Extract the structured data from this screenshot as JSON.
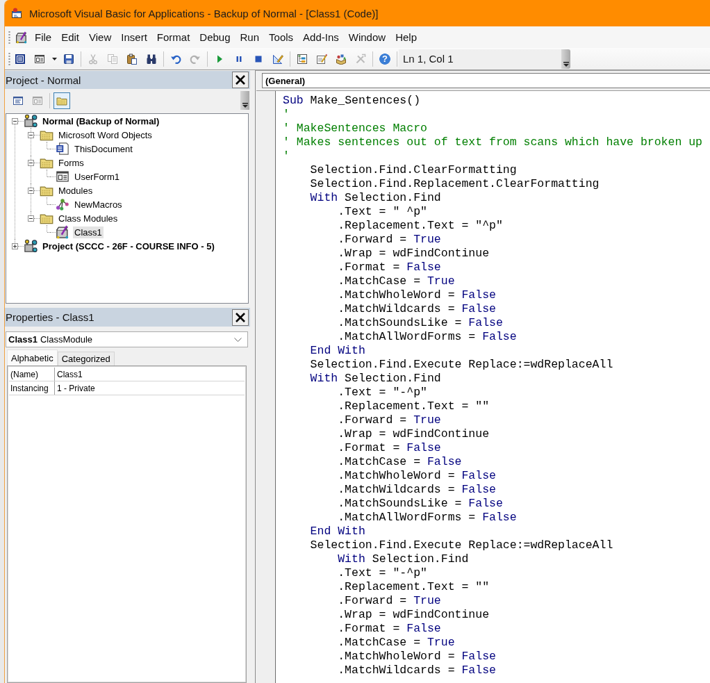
{
  "window": {
    "title": "Microsoft Visual Basic for Applications - Backup of Normal - [Class1 (Code)]"
  },
  "menu_bar": {
    "items": [
      {
        "label": "File"
      },
      {
        "label": "Edit"
      },
      {
        "label": "View"
      },
      {
        "label": "Insert"
      },
      {
        "label": "Format"
      },
      {
        "label": "Debug"
      },
      {
        "label": "Run"
      },
      {
        "label": "Tools"
      },
      {
        "label": "Add-Ins"
      },
      {
        "label": "Window"
      },
      {
        "label": "Help"
      }
    ]
  },
  "toolbar": {
    "items": [
      {
        "kind": "word",
        "disabled": false
      },
      {
        "kind": "userform",
        "disabled": false
      },
      {
        "kind": "save",
        "disabled": false
      },
      {
        "kind": "separator"
      },
      {
        "kind": "cut",
        "disabled": true
      },
      {
        "kind": "copy",
        "disabled": true
      },
      {
        "kind": "paste",
        "disabled": false
      },
      {
        "kind": "find",
        "disabled": false
      },
      {
        "kind": "separator"
      },
      {
        "kind": "undo",
        "disabled": false
      },
      {
        "kind": "redo",
        "disabled": true
      },
      {
        "kind": "separator"
      },
      {
        "kind": "run",
        "disabled": false
      },
      {
        "kind": "pause",
        "disabled": false
      },
      {
        "kind": "stop",
        "disabled": false
      },
      {
        "kind": "design",
        "disabled": false
      },
      {
        "kind": "separator"
      },
      {
        "kind": "project_explorer",
        "disabled": false
      },
      {
        "kind": "properties",
        "disabled": false
      },
      {
        "kind": "object_browser",
        "disabled": false
      },
      {
        "kind": "toolbox",
        "disabled": true
      },
      {
        "kind": "separator"
      },
      {
        "kind": "help",
        "glyph": "?",
        "disabled": false
      },
      {
        "kind": "separator"
      }
    ],
    "position": "Ln 1, Col 1"
  },
  "project_explorer": {
    "title": "Project - Normal",
    "toolbar": [
      {
        "kind": "view_code",
        "disabled": false,
        "selected": false
      },
      {
        "kind": "view_object",
        "disabled": true,
        "selected": false
      },
      {
        "kind": "separator"
      },
      {
        "kind": "toggle_folders",
        "disabled": false,
        "selected": true
      }
    ],
    "tree": [
      {
        "kind": "project",
        "label": "Normal (Backup of Normal)",
        "expanded": true,
        "selected": false,
        "children": [
          {
            "kind": "folder",
            "label": "Microsoft Word Objects",
            "expanded": true,
            "selected": false,
            "children": [
              {
                "kind": "document",
                "label": "ThisDocument",
                "selected": false
              }
            ]
          },
          {
            "kind": "folder",
            "label": "Forms",
            "expanded": true,
            "selected": false,
            "children": [
              {
                "kind": "form",
                "label": "UserForm1",
                "selected": false
              }
            ]
          },
          {
            "kind": "folder",
            "label": "Modules",
            "expanded": true,
            "selected": false,
            "children": [
              {
                "kind": "module",
                "label": "NewMacros",
                "selected": false
              }
            ]
          },
          {
            "kind": "folder",
            "label": "Class Modules",
            "expanded": true,
            "selected": false,
            "children": [
              {
                "kind": "class",
                "label": "Class1",
                "selected": true
              }
            ]
          }
        ]
      },
      {
        "kind": "project",
        "label": "Project (SCCC - 26F - COURSE INFO - 5)",
        "expanded": false,
        "selected": false
      }
    ]
  },
  "properties": {
    "title": "Properties - Class1",
    "object": {
      "name": "Class1",
      "type": "ClassModule"
    },
    "tabs": [
      {
        "label": "Alphabetic",
        "selected": true
      },
      {
        "label": "Categorized",
        "selected": false
      }
    ],
    "rows": [
      {
        "name": "(Name)",
        "value": "Class1"
      },
      {
        "name": "Instancing",
        "value": "1 - Private"
      }
    ]
  },
  "code_window": {
    "object": "(General)",
    "lines": [
      {
        "tokens": [
          {
            "kind": "keyword",
            "text": "Sub"
          },
          {
            "kind": "plain",
            "text": " Make_Sentences()"
          }
        ]
      },
      {
        "tokens": [
          {
            "kind": "comment",
            "text": "'"
          }
        ]
      },
      {
        "tokens": [
          {
            "kind": "comment",
            "text": "' MakeSentences Macro"
          }
        ]
      },
      {
        "tokens": [
          {
            "kind": "comment",
            "text": "' Makes sentences out of text from scans which have broken up"
          }
        ]
      },
      {
        "tokens": [
          {
            "kind": "comment",
            "text": "'"
          }
        ]
      },
      {
        "tokens": [
          {
            "kind": "plain",
            "text": "    Selection.Find.ClearFormatting"
          }
        ]
      },
      {
        "tokens": [
          {
            "kind": "plain",
            "text": "    Selection.Find.Replacement.ClearFormatting"
          }
        ]
      },
      {
        "tokens": [
          {
            "kind": "keyword",
            "text": "    With"
          },
          {
            "kind": "plain",
            "text": " Selection.Find"
          }
        ]
      },
      {
        "tokens": [
          {
            "kind": "plain",
            "text": "        .Text = \" ^p\""
          }
        ]
      },
      {
        "tokens": [
          {
            "kind": "plain",
            "text": "        .Replacement.Text = \"^p\""
          }
        ]
      },
      {
        "tokens": [
          {
            "kind": "plain",
            "text": "        .Forward = "
          },
          {
            "kind": "keyword",
            "text": "True"
          }
        ]
      },
      {
        "tokens": [
          {
            "kind": "plain",
            "text": "        .Wrap = wdFindContinue"
          }
        ]
      },
      {
        "tokens": [
          {
            "kind": "plain",
            "text": "        .Format = "
          },
          {
            "kind": "keyword",
            "text": "False"
          }
        ]
      },
      {
        "tokens": [
          {
            "kind": "plain",
            "text": "        .MatchCase = "
          },
          {
            "kind": "keyword",
            "text": "True"
          }
        ]
      },
      {
        "tokens": [
          {
            "kind": "plain",
            "text": "        .MatchWholeWord = "
          },
          {
            "kind": "keyword",
            "text": "False"
          }
        ]
      },
      {
        "tokens": [
          {
            "kind": "plain",
            "text": "        .MatchWildcards = "
          },
          {
            "kind": "keyword",
            "text": "False"
          }
        ]
      },
      {
        "tokens": [
          {
            "kind": "plain",
            "text": "        .MatchSoundsLike = "
          },
          {
            "kind": "keyword",
            "text": "False"
          }
        ]
      },
      {
        "tokens": [
          {
            "kind": "plain",
            "text": "        .MatchAllWordForms = "
          },
          {
            "kind": "keyword",
            "text": "False"
          }
        ]
      },
      {
        "tokens": [
          {
            "kind": "keyword",
            "text": "    End With"
          }
        ]
      },
      {
        "tokens": [
          {
            "kind": "plain",
            "text": "    Selection.Find.Execute Replace:=wdReplaceAll"
          }
        ]
      },
      {
        "tokens": [
          {
            "kind": "keyword",
            "text": "    With"
          },
          {
            "kind": "plain",
            "text": " Selection.Find"
          }
        ]
      },
      {
        "tokens": [
          {
            "kind": "plain",
            "text": "        .Text = \"-^p\""
          }
        ]
      },
      {
        "tokens": [
          {
            "kind": "plain",
            "text": "        .Replacement.Text = \"\""
          }
        ]
      },
      {
        "tokens": [
          {
            "kind": "plain",
            "text": "        .Forward = "
          },
          {
            "kind": "keyword",
            "text": "True"
          }
        ]
      },
      {
        "tokens": [
          {
            "kind": "plain",
            "text": "        .Wrap = wdFindContinue"
          }
        ]
      },
      {
        "tokens": [
          {
            "kind": "plain",
            "text": "        .Format = "
          },
          {
            "kind": "keyword",
            "text": "False"
          }
        ]
      },
      {
        "tokens": [
          {
            "kind": "plain",
            "text": "        .MatchCase = "
          },
          {
            "kind": "keyword",
            "text": "False"
          }
        ]
      },
      {
        "tokens": [
          {
            "kind": "plain",
            "text": "        .MatchWholeWord = "
          },
          {
            "kind": "keyword",
            "text": "False"
          }
        ]
      },
      {
        "tokens": [
          {
            "kind": "plain",
            "text": "        .MatchWildcards = "
          },
          {
            "kind": "keyword",
            "text": "False"
          }
        ]
      },
      {
        "tokens": [
          {
            "kind": "plain",
            "text": "        .MatchSoundsLike = "
          },
          {
            "kind": "keyword",
            "text": "False"
          }
        ]
      },
      {
        "tokens": [
          {
            "kind": "plain",
            "text": "        .MatchAllWordForms = "
          },
          {
            "kind": "keyword",
            "text": "False"
          }
        ]
      },
      {
        "tokens": [
          {
            "kind": "keyword",
            "text": "    End With"
          }
        ]
      },
      {
        "tokens": [
          {
            "kind": "plain",
            "text": "    Selection.Find.Execute Replace:=wdReplaceAll"
          }
        ]
      },
      {
        "tokens": [
          {
            "kind": "keyword",
            "text": "        With"
          },
          {
            "kind": "plain",
            "text": " Selection.Find"
          }
        ]
      },
      {
        "tokens": [
          {
            "kind": "plain",
            "text": "        .Text = \"-^p\""
          }
        ]
      },
      {
        "tokens": [
          {
            "kind": "plain",
            "text": "        .Replacement.Text = \"\""
          }
        ]
      },
      {
        "tokens": [
          {
            "kind": "plain",
            "text": "        .Forward = "
          },
          {
            "kind": "keyword",
            "text": "True"
          }
        ]
      },
      {
        "tokens": [
          {
            "kind": "plain",
            "text": "        .Wrap = wdFindContinue"
          }
        ]
      },
      {
        "tokens": [
          {
            "kind": "plain",
            "text": "        .Format = "
          },
          {
            "kind": "keyword",
            "text": "False"
          }
        ]
      },
      {
        "tokens": [
          {
            "kind": "plain",
            "text": "        .MatchCase = "
          },
          {
            "kind": "keyword",
            "text": "True"
          }
        ]
      },
      {
        "tokens": [
          {
            "kind": "plain",
            "text": "        .MatchWholeWord = "
          },
          {
            "kind": "keyword",
            "text": "False"
          }
        ]
      },
      {
        "tokens": [
          {
            "kind": "plain",
            "text": "        .MatchWildcards = "
          },
          {
            "kind": "keyword",
            "text": "False"
          }
        ]
      }
    ]
  }
}
